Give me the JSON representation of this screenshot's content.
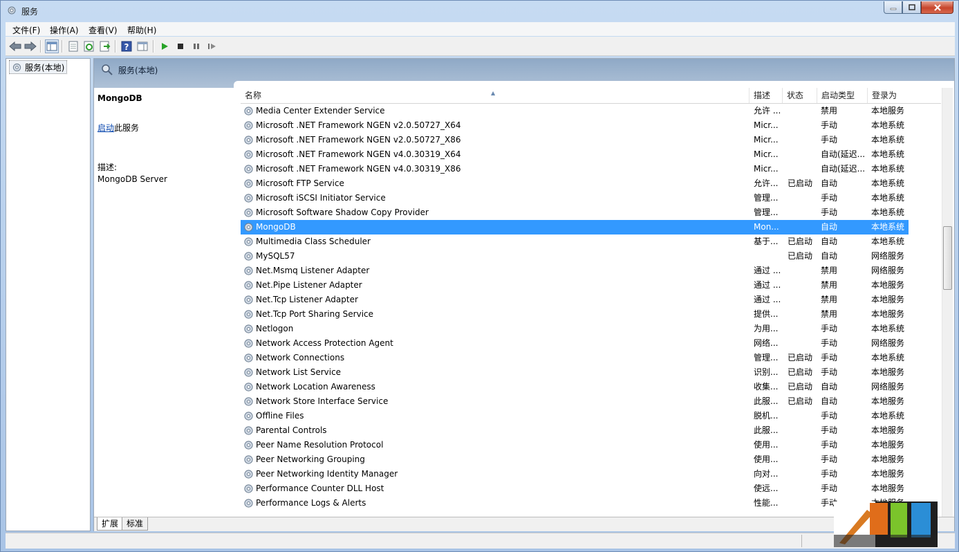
{
  "window": {
    "title": "服务"
  },
  "menu": [
    {
      "label": "文件(F)"
    },
    {
      "label": "操作(A)"
    },
    {
      "label": "查看(V)"
    },
    {
      "label": "帮助(H)"
    }
  ],
  "tree": {
    "root_label": "服务(本地)"
  },
  "header": {
    "title": "服务(本地)"
  },
  "detail": {
    "service_name": "MongoDB",
    "action_link": "启动",
    "action_suffix": "此服务",
    "desc_label": "描述:",
    "desc": "MongoDB Server"
  },
  "columns": {
    "name": "名称",
    "desc": "描述",
    "state": "状态",
    "startup": "启动类型",
    "logon": "登录为"
  },
  "rows": [
    {
      "name": "Media Center Extender Service",
      "desc": "允许 ...",
      "state": "",
      "startup": "禁用",
      "logon": "本地服务"
    },
    {
      "name": "Microsoft .NET Framework NGEN v2.0.50727_X64",
      "desc": "Micr...",
      "state": "",
      "startup": "手动",
      "logon": "本地系统"
    },
    {
      "name": "Microsoft .NET Framework NGEN v2.0.50727_X86",
      "desc": "Micr...",
      "state": "",
      "startup": "手动",
      "logon": "本地系统"
    },
    {
      "name": "Microsoft .NET Framework NGEN v4.0.30319_X64",
      "desc": "Micr...",
      "state": "",
      "startup": "自动(延迟...",
      "logon": "本地系统"
    },
    {
      "name": "Microsoft .NET Framework NGEN v4.0.30319_X86",
      "desc": "Micr...",
      "state": "",
      "startup": "自动(延迟...",
      "logon": "本地系统"
    },
    {
      "name": "Microsoft FTP Service",
      "desc": "允许...",
      "state": "已启动",
      "startup": "自动",
      "logon": "本地系统"
    },
    {
      "name": "Microsoft iSCSI Initiator Service",
      "desc": "管理...",
      "state": "",
      "startup": "手动",
      "logon": "本地系统"
    },
    {
      "name": "Microsoft Software Shadow Copy Provider",
      "desc": "管理...",
      "state": "",
      "startup": "手动",
      "logon": "本地系统"
    },
    {
      "name": "MongoDB",
      "desc": "Mon...",
      "state": "",
      "startup": "自动",
      "logon": "本地系统",
      "selected": true
    },
    {
      "name": "Multimedia Class Scheduler",
      "desc": "基于...",
      "state": "已启动",
      "startup": "自动",
      "logon": "本地系统"
    },
    {
      "name": "MySQL57",
      "desc": "",
      "state": "已启动",
      "startup": "自动",
      "logon": "网络服务"
    },
    {
      "name": "Net.Msmq Listener Adapter",
      "desc": "通过 ...",
      "state": "",
      "startup": "禁用",
      "logon": "网络服务"
    },
    {
      "name": "Net.Pipe Listener Adapter",
      "desc": "通过 ...",
      "state": "",
      "startup": "禁用",
      "logon": "本地服务"
    },
    {
      "name": "Net.Tcp Listener Adapter",
      "desc": "通过 ...",
      "state": "",
      "startup": "禁用",
      "logon": "本地服务"
    },
    {
      "name": "Net.Tcp Port Sharing Service",
      "desc": "提供...",
      "state": "",
      "startup": "禁用",
      "logon": "本地服务"
    },
    {
      "name": "Netlogon",
      "desc": "为用...",
      "state": "",
      "startup": "手动",
      "logon": "本地系统"
    },
    {
      "name": "Network Access Protection Agent",
      "desc": "网络...",
      "state": "",
      "startup": "手动",
      "logon": "网络服务"
    },
    {
      "name": "Network Connections",
      "desc": "管理...",
      "state": "已启动",
      "startup": "手动",
      "logon": "本地系统"
    },
    {
      "name": "Network List Service",
      "desc": "识别...",
      "state": "已启动",
      "startup": "手动",
      "logon": "本地服务"
    },
    {
      "name": "Network Location Awareness",
      "desc": "收集...",
      "state": "已启动",
      "startup": "自动",
      "logon": "网络服务"
    },
    {
      "name": "Network Store Interface Service",
      "desc": "此服...",
      "state": "已启动",
      "startup": "自动",
      "logon": "本地服务"
    },
    {
      "name": "Offline Files",
      "desc": "脱机...",
      "state": "",
      "startup": "手动",
      "logon": "本地系统"
    },
    {
      "name": "Parental Controls",
      "desc": "此服...",
      "state": "",
      "startup": "手动",
      "logon": "本地服务"
    },
    {
      "name": "Peer Name Resolution Protocol",
      "desc": "使用...",
      "state": "",
      "startup": "手动",
      "logon": "本地服务"
    },
    {
      "name": "Peer Networking Grouping",
      "desc": "使用...",
      "state": "",
      "startup": "手动",
      "logon": "本地服务"
    },
    {
      "name": "Peer Networking Identity Manager",
      "desc": "向对...",
      "state": "",
      "startup": "手动",
      "logon": "本地服务"
    },
    {
      "name": "Performance Counter DLL Host",
      "desc": "使远...",
      "state": "",
      "startup": "手动",
      "logon": "本地服务"
    },
    {
      "name": "Performance Logs & Alerts",
      "desc": "性能...",
      "state": "",
      "startup": "手动",
      "logon": "本地服务"
    }
  ],
  "tabs": [
    {
      "label": "扩展",
      "active": true
    },
    {
      "label": "标准",
      "active": false
    }
  ],
  "colors": {
    "selection": "#3399ff",
    "header_band": "#8fa9c6",
    "link": "#0645ad"
  },
  "icons": [
    "gear-icon",
    "back-arrow-icon",
    "forward-arrow-icon",
    "console-tree-icon",
    "properties-icon",
    "refresh-icon",
    "export-icon",
    "help-icon",
    "show-pane-icon",
    "play-icon",
    "stop-icon",
    "pause-icon",
    "resume-icon"
  ]
}
